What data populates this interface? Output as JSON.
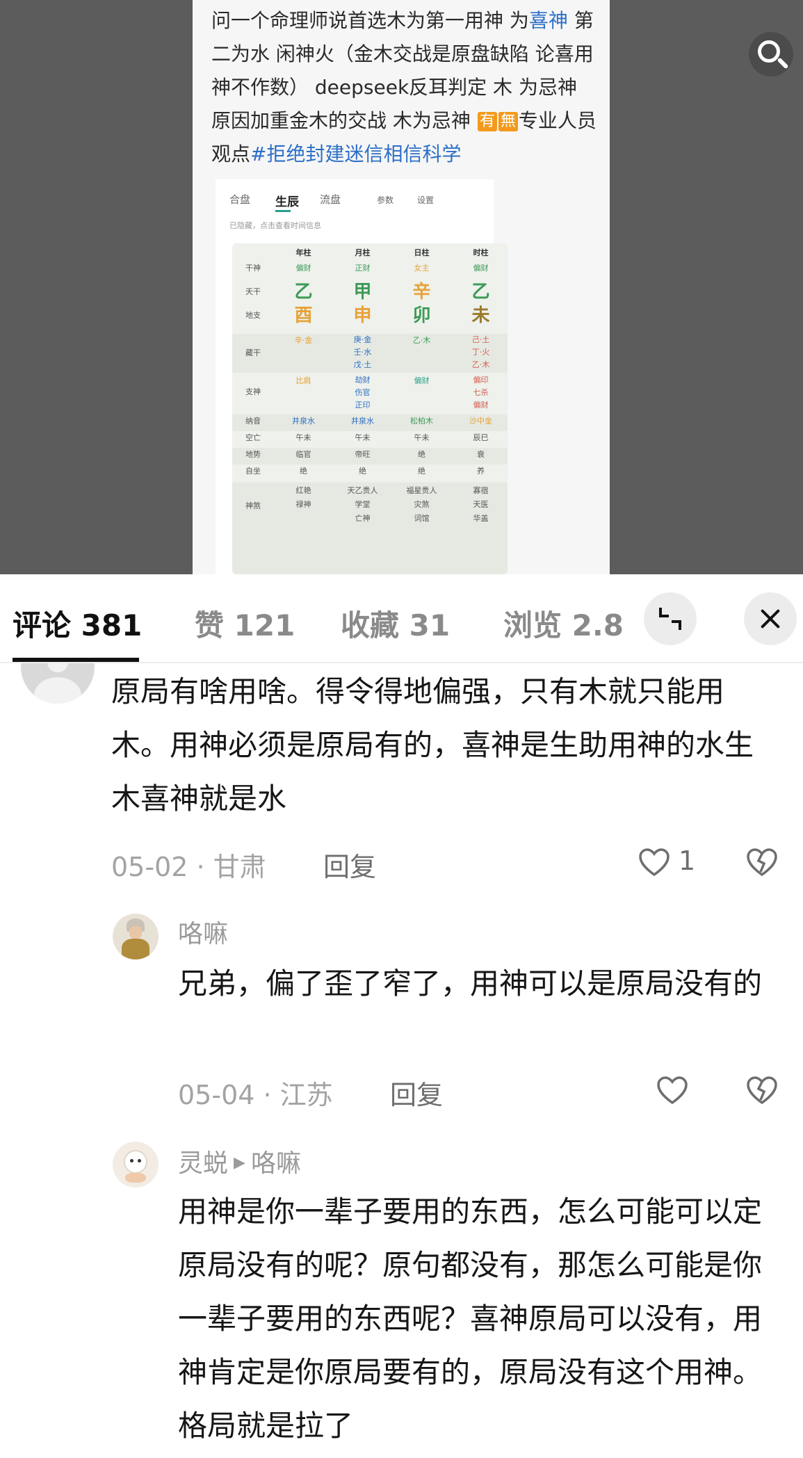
{
  "post": {
    "text_before_1": "问一个命理师说首选木为第一用神 为",
    "link_1": "喜神",
    "text_after_1": " 第二为水 闲神火（金木交战是原盘缺陷 论喜用神不作数） deepseek反耳判定 木 为忌神 原因加重金木的交战 木为忌神 ",
    "tag_1": "有",
    "tag_2": "無",
    "text_after_2": "专业人员观点",
    "hashtag": "#拒绝封建迷信相信科学"
  },
  "bazi_card": {
    "tabs": [
      "合盘",
      "生辰",
      "流盘"
    ],
    "params_label": "参数",
    "settings_label": "设置",
    "hint": "已隐藏，点击查看时间信息",
    "columns": [
      "年柱",
      "月柱",
      "日柱",
      "时柱"
    ],
    "rows": [
      {
        "label": "干神",
        "cells": [
          "偏财",
          "正财",
          "女主",
          "偏财"
        ]
      },
      {
        "label": "天干",
        "cells": [
          "乙",
          "甲",
          "辛",
          "乙"
        ]
      },
      {
        "label": "地支",
        "cells": [
          "酉",
          "申",
          "卯",
          "未"
        ]
      },
      {
        "label": "藏干",
        "cells": [
          "辛·金",
          "庚·金\n壬·水\n戊·土",
          "乙·木",
          "己·土\n丁·火\n乙·木"
        ]
      },
      {
        "label": "支神",
        "cells": [
          "比肩",
          "劫财\n伤官\n正印",
          "偏财",
          "偏印\n七杀\n偏财"
        ]
      },
      {
        "label": "纳音",
        "cells": [
          "井泉水",
          "井泉水",
          "松柏木",
          "沙中金"
        ]
      },
      {
        "label": "空亡",
        "cells": [
          "午未",
          "午未",
          "午未",
          "辰巳"
        ]
      },
      {
        "label": "地势",
        "cells": [
          "临官",
          "帝旺",
          "绝",
          "衰"
        ]
      },
      {
        "label": "自坐",
        "cells": [
          "绝",
          "绝",
          "绝",
          "养"
        ]
      },
      {
        "label": "神煞",
        "cells": [
          "红艳\n禄神",
          "天乙贵人\n学堂\n亡神",
          "福星贵人\n灾煞\n词馆",
          "寡宿\n天医\n华盖"
        ]
      }
    ]
  },
  "tabs": {
    "comments": "评论 381",
    "likes": "赞 121",
    "favorites": "收藏 31",
    "views": "浏览 2.8"
  },
  "comments": [
    {
      "text": "原局有啥用啥。得令得地偏强，只有木就只能用木。用神必须是原局有的，喜神是生助用神的水生木喜神就是水",
      "date_loc": "05-02 · 甘肃",
      "reply": "回复",
      "likes": "1"
    },
    {
      "user": "咯嘛",
      "text": "兄弟，偏了歪了窄了，用神可以是原局没有的",
      "date_loc": "05-04 · 江苏",
      "reply": "回复",
      "likes": ""
    },
    {
      "user": "灵蜕",
      "reply_to": "咯嘛",
      "text": "用神是你一辈子要用的东西，怎么可能可以定原局没有的呢？原句都没有，那怎么可能是你一辈子要用的东西呢？喜神原局可以没有，用神肯定是你原局要有的，原局没有这个用神。格局就是拉了"
    }
  ]
}
